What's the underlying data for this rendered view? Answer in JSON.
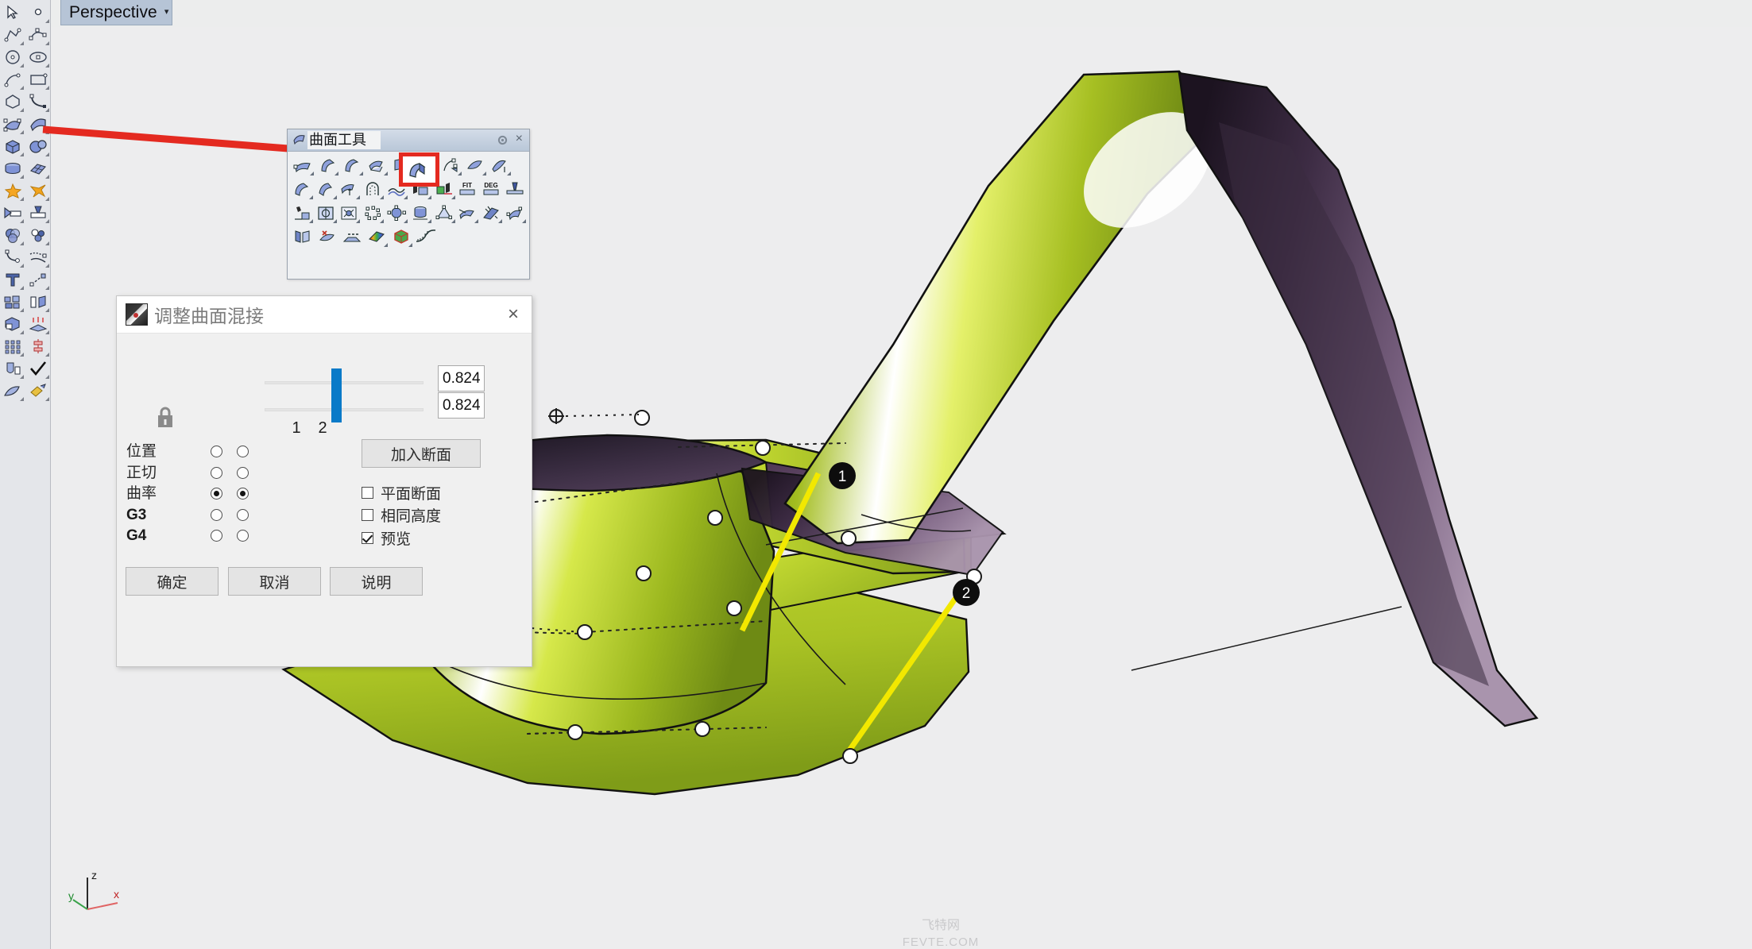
{
  "viewport": {
    "label": "Perspective",
    "caret": "▾",
    "axis": {
      "z": "z",
      "y": "y",
      "x": "x"
    },
    "watermark_cn": "飞特网",
    "watermark_en": "FEVTE.COM",
    "markers": [
      {
        "label": "1"
      },
      {
        "label": "2"
      }
    ]
  },
  "surface_toolbar": {
    "title": "曲面工具",
    "gear_icon": "gear-icon",
    "close_icon": "close-icon",
    "close_label": "×",
    "rows": [
      [
        "surface-from-edges",
        "loft",
        "sweep1",
        "sweep2",
        "revolve",
        "blend-surface",
        "rail-revolve",
        "patch",
        "network-surface"
      ],
      [
        "extrude-straight",
        "extrude-tapered",
        "extrude-ribbon",
        "pipe",
        "drape",
        "heightfield",
        "terrain",
        "fit-surface",
        "degree-surface"
      ],
      [
        "surface-from-points",
        "plane-through-points",
        "fit-plane",
        "point-grid",
        "point-cloud",
        "cylinder-object",
        "triangle-surface",
        "offset-surface",
        "explode-surface"
      ],
      [
        "unroll-surface",
        "untrim-surface",
        "blend-curve",
        "zebra-analysis",
        "box-edit",
        "curvature-graph"
      ]
    ],
    "highlight_index": 5,
    "highlight_color": "#e42a20"
  },
  "dialog": {
    "title": "调整曲面混接",
    "close_label": "×",
    "lock_icon": "lock-icon",
    "sliders": [
      {
        "name": "blend-slider-1",
        "value": 0.824,
        "percent": 43
      },
      {
        "name": "blend-slider-2",
        "value": 0.824,
        "percent": 43
      }
    ],
    "value_fields": [
      {
        "name": "blend-value-1",
        "value": "0.824"
      },
      {
        "name": "blend-value-2",
        "value": "0.824"
      }
    ],
    "column_headers": [
      "1",
      "2"
    ],
    "continuity_rows": [
      {
        "label": "位置",
        "latin": false,
        "col1": false,
        "col2": false
      },
      {
        "label": "正切",
        "latin": false,
        "col1": false,
        "col2": false
      },
      {
        "label": "曲率",
        "latin": false,
        "col1": true,
        "col2": true
      },
      {
        "label": "G3",
        "latin": true,
        "col1": false,
        "col2": false
      },
      {
        "label": "G4",
        "latin": true,
        "col1": false,
        "col2": false
      }
    ],
    "add_section_button": "加入断面",
    "checkboxes": [
      {
        "label": "平面断面",
        "checked": false
      },
      {
        "label": "相同高度",
        "checked": false
      },
      {
        "label": "预览",
        "checked": true
      }
    ],
    "buttons": {
      "ok": "确定",
      "cancel": "取消",
      "help": "说明"
    },
    "accent_color": "#0a7ac8"
  },
  "model": {
    "surface_green": "#b3c928",
    "surface_purple": "#6d5170",
    "edge_color": "#111111",
    "direction_line_color": "#f2e800",
    "control_point_fill": "#ffffff"
  },
  "annotation": {
    "arrow_color": "#e42a20",
    "name": "pointer-arrow"
  }
}
